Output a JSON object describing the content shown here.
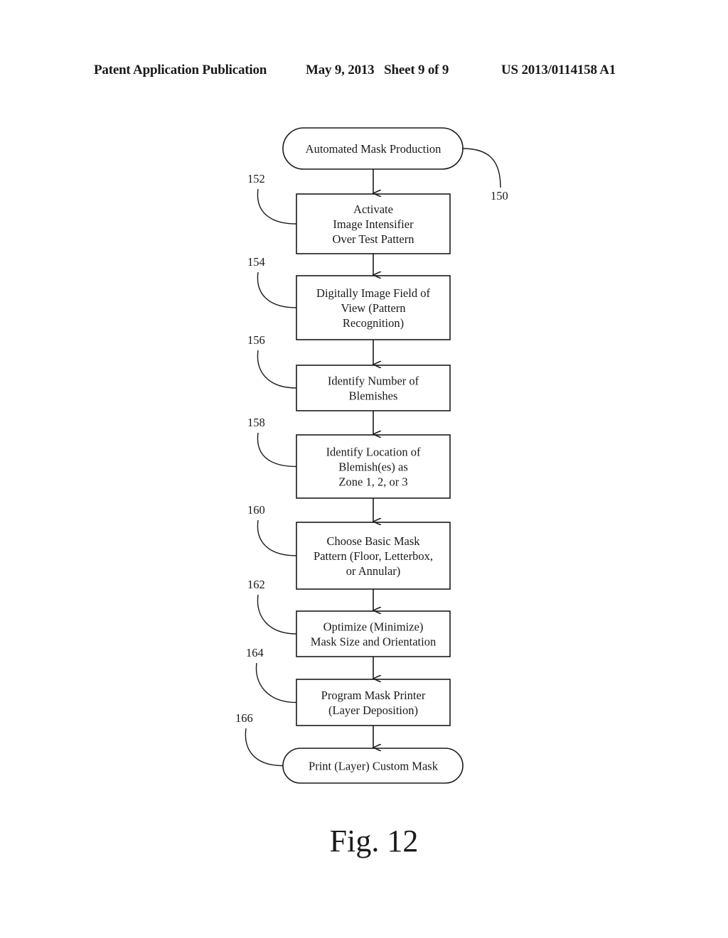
{
  "header": {
    "publication_type": "Patent Application Publication",
    "date_sheet": "May 9, 2013   Sheet 9 of 9",
    "publication_number": "US 2013/0114158 A1"
  },
  "flowchart": {
    "ref": "150",
    "nodes": [
      {
        "id": "start",
        "shape": "terminal",
        "ref": "",
        "lines": [
          "Automated Mask Production"
        ]
      },
      {
        "id": "s152",
        "shape": "process",
        "ref": "152",
        "lines": [
          "Activate",
          "Image Intensifier",
          "Over Test Pattern"
        ]
      },
      {
        "id": "s154",
        "shape": "process",
        "ref": "154",
        "lines": [
          "Digitally Image Field of",
          "View (Pattern",
          "Recognition)"
        ]
      },
      {
        "id": "s156",
        "shape": "process",
        "ref": "156",
        "lines": [
          "Identify Number of",
          "Blemishes"
        ]
      },
      {
        "id": "s158",
        "shape": "process",
        "ref": "158",
        "lines": [
          "Identify Location of",
          "Blemish(es) as",
          "Zone 1, 2, or 3"
        ]
      },
      {
        "id": "s160",
        "shape": "process",
        "ref": "160",
        "lines": [
          "Choose Basic Mask",
          "Pattern (Floor, Letterbox,",
          "or Annular)"
        ]
      },
      {
        "id": "s162",
        "shape": "process",
        "ref": "162",
        "lines": [
          "Optimize (Minimize)",
          "Mask Size and Orientation"
        ]
      },
      {
        "id": "s164",
        "shape": "process",
        "ref": "164",
        "lines": [
          "Program Mask Printer",
          "(Layer Deposition)"
        ]
      },
      {
        "id": "end",
        "shape": "terminal",
        "ref": "166",
        "lines": [
          "Print (Layer) Custom Mask"
        ]
      }
    ]
  },
  "figure_label": "Fig. 12"
}
